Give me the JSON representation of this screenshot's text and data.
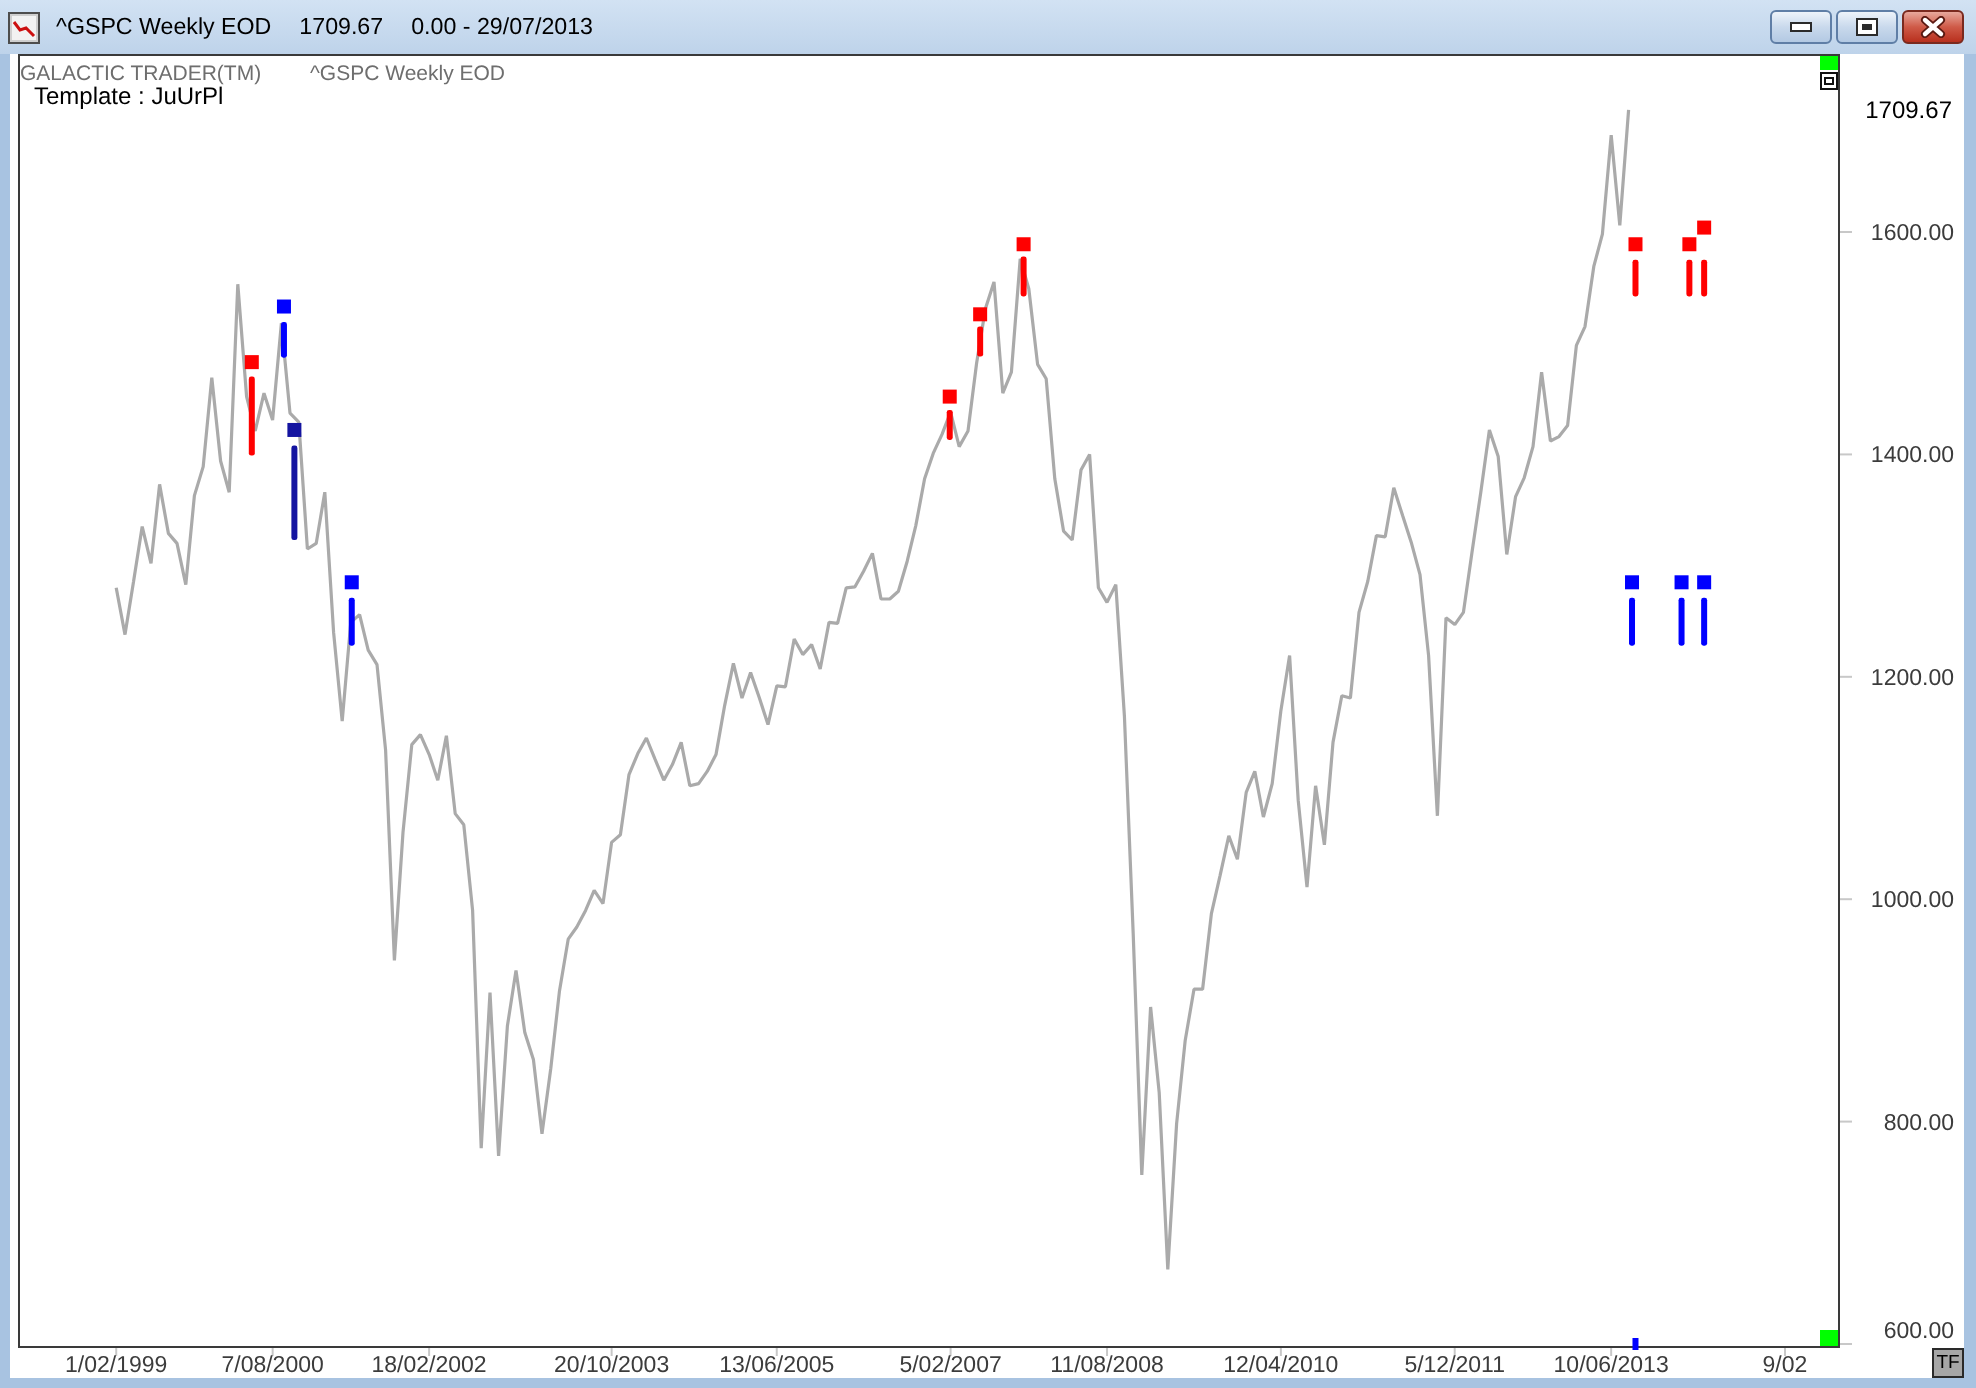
{
  "window": {
    "title_symbol": "^GSPC Weekly EOD",
    "title_price": "1709.67",
    "title_change_date": "0.00 - 29/07/2013"
  },
  "chart": {
    "brand": "GALACTIC TRADER(TM)",
    "template": "Template : JuUrPl",
    "price_label": "1709.67",
    "tf_button": "TF",
    "chart_data": {
      "type": "line",
      "categories": [
        null,
        null,
        null,
        null,
        null,
        null,
        null,
        null,
        null,
        null,
        null,
        "1/02/1999",
        null,
        null,
        null,
        null,
        null,
        null,
        null,
        null,
        null,
        null,
        null,
        null,
        null,
        null,
        null,
        null,
        null,
        "7/08/2000",
        null,
        null,
        null,
        null,
        null,
        null,
        null,
        null,
        null,
        null,
        null,
        null,
        null,
        null,
        null,
        null,
        null,
        "18/02/2002",
        null,
        null,
        null,
        null,
        null,
        null,
        null,
        null,
        null,
        null,
        null,
        null,
        null,
        null,
        null,
        null,
        null,
        null,
        null,
        null,
        "20/10/2003",
        null,
        null,
        null,
        null,
        null,
        null,
        null,
        null,
        null,
        null,
        null,
        null,
        null,
        null,
        null,
        null,
        null,
        null,
        "13/06/2005",
        null,
        null,
        null,
        null,
        null,
        null,
        null,
        null,
        null,
        null,
        null,
        null,
        null,
        null,
        null,
        null,
        null,
        null,
        null,
        "5/02/2007",
        null,
        null,
        null,
        null,
        null,
        null,
        null,
        null,
        null,
        null,
        null,
        null,
        null,
        null,
        null,
        null,
        null,
        "11/08/2008",
        null,
        null,
        null,
        null,
        null,
        null,
        null,
        null,
        null,
        null,
        null,
        null,
        null,
        null,
        null,
        null,
        null,
        null,
        null,
        "12/04/2010",
        null,
        null,
        null,
        null,
        null,
        null,
        null,
        null,
        null,
        null,
        null,
        null,
        null,
        null,
        null,
        null,
        null,
        null,
        null,
        "5/12/2011",
        null,
        null,
        null,
        null,
        null,
        null,
        null,
        null,
        null,
        null,
        null,
        null,
        null,
        null,
        null,
        null,
        null,
        "10/06/2013",
        null,
        null,
        null,
        null,
        null,
        null,
        null,
        null,
        null,
        null,
        null,
        null,
        null,
        null,
        null,
        null,
        null,
        null,
        null,
        "9/02",
        null,
        null,
        null,
        null,
        null,
        null
      ],
      "series": [
        {
          "name": "^GSPC Weekly EOD",
          "color": "#aaaaaa",
          "values": [
            null,
            null,
            null,
            null,
            null,
            null,
            null,
            null,
            null,
            null,
            null,
            1280,
            1238,
            1286,
            1335,
            1302,
            1373,
            1329,
            1320,
            1283,
            1363,
            1389,
            1469,
            1394,
            1366,
            1553,
            1452,
            1421,
            1455,
            1431,
            1518,
            1437,
            1429,
            1315,
            1320,
            1366,
            1240,
            1160,
            1249,
            1256,
            1224,
            1211,
            1134,
            945,
            1060,
            1139,
            1148,
            1130,
            1107,
            1147,
            1077,
            1067,
            990,
            776,
            916,
            769,
            886,
            936,
            880,
            856,
            789,
            848,
            917,
            964,
            975,
            990,
            1008,
            996,
            1051,
            1058,
            1112,
            1131,
            1145,
            1126,
            1107,
            1121,
            1141,
            1102,
            1104,
            1115,
            1130,
            1174,
            1212,
            1181,
            1204,
            1181,
            1157,
            1192,
            1191,
            1234,
            1220,
            1229,
            1207,
            1249,
            1248,
            1280,
            1281,
            1295,
            1311,
            1270,
            1270,
            1277,
            1304,
            1336,
            1378,
            1401,
            1418,
            1438,
            1407,
            1421,
            1482,
            1531,
            1555,
            1455,
            1474,
            1576,
            1549,
            1481,
            1468,
            1378,
            1331,
            1323,
            1386,
            1400,
            1280,
            1267,
            1283,
            1165,
            969,
            752,
            903,
            826,
            667,
            798,
            873,
            919,
            919,
            987,
            1021,
            1057,
            1036,
            1096,
            1115,
            1074,
            1104,
            1169,
            1219,
            1089,
            1011,
            1102,
            1049,
            1141,
            1183,
            1181,
            1258,
            1286,
            1327,
            1326,
            1370,
            1345,
            1321,
            1292,
            1219,
            1075,
            1253,
            1247,
            1258,
            1312,
            1366,
            1422,
            1398,
            1310,
            1362,
            1379,
            1407,
            1474,
            1412,
            1416,
            1426,
            1498,
            1515,
            1569,
            1598,
            1687,
            1606,
            1710,
            null,
            null,
            null,
            null,
            null,
            null,
            null,
            null,
            null,
            null,
            null,
            null,
            null,
            null,
            null,
            null,
            null,
            null,
            null,
            null,
            null,
            null,
            null,
            null
          ]
        }
      ],
      "ylim": [
        598.2,
        1760.1
      ],
      "yticks": [
        {
          "value": 600,
          "label": "600.00"
        },
        {
          "value": 800,
          "label": "800.00"
        },
        {
          "value": 1000,
          "label": "1000.00"
        },
        {
          "value": 1200,
          "label": "1200.00"
        },
        {
          "value": 1400,
          "label": "1400.00"
        },
        {
          "value": 1600,
          "label": "1600.00"
        }
      ]
    },
    "signals": [
      {
        "kind": "signal",
        "color": "#ff0000"
      },
      {
        "kind": "signal",
        "color": "#0000ff"
      },
      {
        "kind": "signal",
        "color": "#1414a0"
      },
      {
        "kind": "signal",
        "color": "#0000ff"
      },
      {
        "kind": "signal",
        "color": "#ff0000"
      },
      {
        "kind": "signal",
        "color": "#ff0000"
      },
      {
        "kind": "signal",
        "color": "#ff0000"
      },
      {
        "kind": "signal",
        "color": "#0000ff"
      },
      {
        "kind": "signal",
        "color": "#ff0000"
      },
      {
        "kind": "tick",
        "color": "#0000ff"
      },
      {
        "kind": "signal",
        "color": "#0000ff"
      },
      {
        "kind": "signal",
        "color": "#ff0000"
      },
      {
        "kind": "signal",
        "color": "#ff0000"
      },
      {
        "kind": "signal",
        "color": "#0000ff"
      }
    ]
  }
}
